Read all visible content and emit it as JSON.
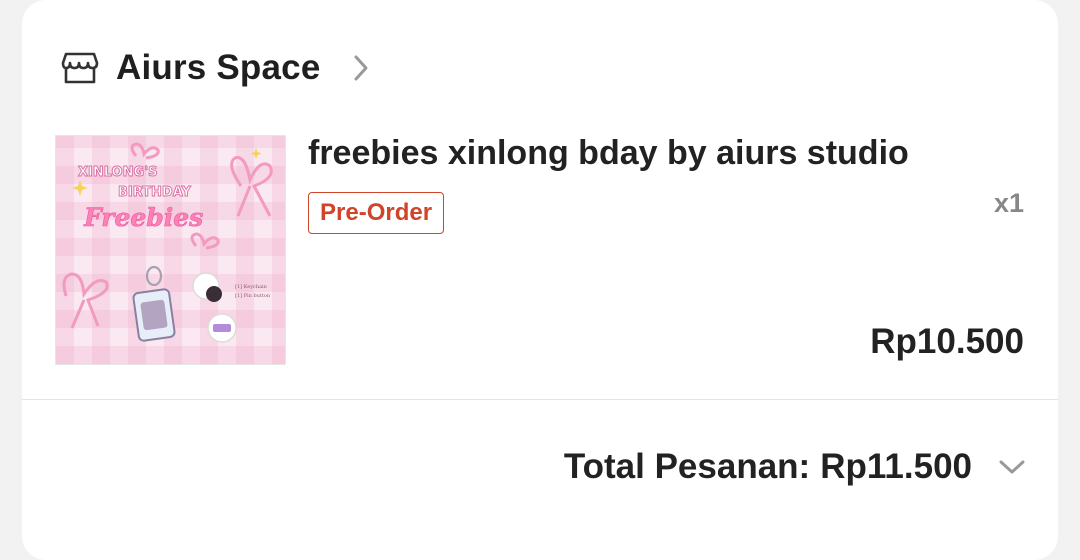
{
  "shop": {
    "name": "Aiurs Space",
    "icon": "store-icon",
    "chevron": "chevron-right-icon"
  },
  "item": {
    "title": "freebies xinlong bday by aiurs studio",
    "badge": "Pre-Order",
    "quantity": "x1",
    "price": "Rp10.500",
    "thumbnail": {
      "heading_line1": "XINLONG'S",
      "heading_line2": "BIRTHDAY",
      "heading_line3": "Freebies",
      "list_line1": "[1] Keychain",
      "list_line2": "[1] Pin button"
    }
  },
  "order": {
    "total_label": "Total Pesanan:",
    "total_value": "Rp11.500",
    "chevron": "chevron-down-icon"
  },
  "colors": {
    "accent": "#d0442a",
    "pink": "#f4a6c4",
    "text": "#222222",
    "muted": "#888888"
  }
}
